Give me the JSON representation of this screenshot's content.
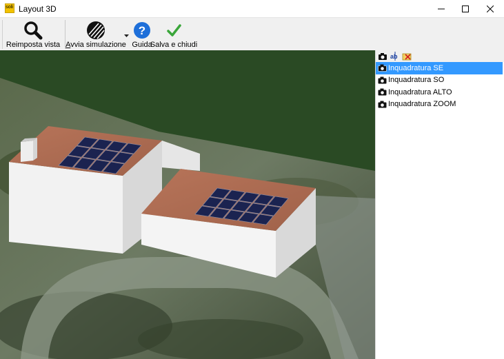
{
  "window": {
    "app_logo_text": "soli",
    "title": "Layout 3D"
  },
  "toolbar": {
    "reset_view_label": "Reimposta vista",
    "start_sim_label_prefix": "A",
    "start_sim_label_rest": "vvia simulazione",
    "help_label": "Guida",
    "save_close_label": "Salva e chiudi"
  },
  "shots_panel": {
    "tools": [
      "camera-add-icon",
      "rename-icon",
      "delete-icon"
    ],
    "items": [
      {
        "label": "Inquadratura SE",
        "selected": true
      },
      {
        "label": "Inquadratura SO",
        "selected": false
      },
      {
        "label": "Inquadratura ALTO",
        "selected": false
      },
      {
        "label": "Inquadratura ZOOM",
        "selected": false
      }
    ]
  },
  "colors": {
    "accent_selection": "#3399ff",
    "help_icon": "#1e6fd9",
    "save_check": "#3aa63a",
    "background_green": "#2a4a24"
  }
}
